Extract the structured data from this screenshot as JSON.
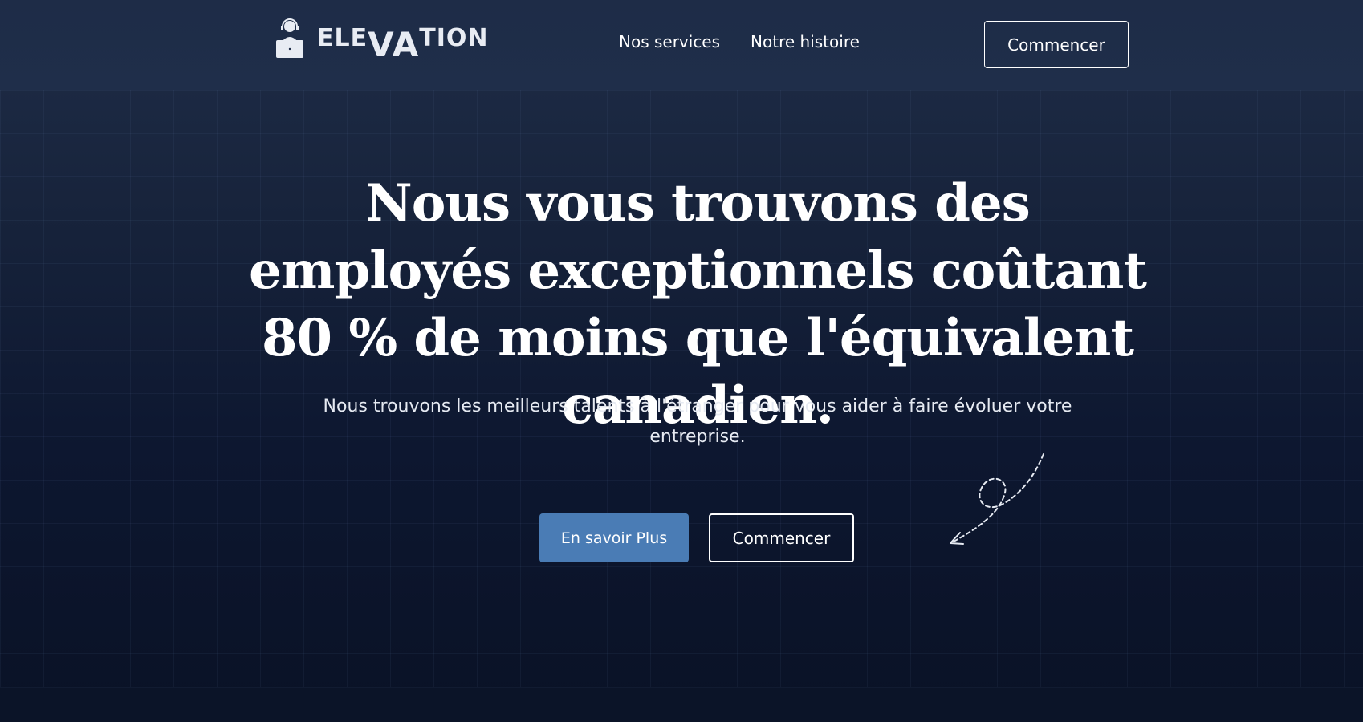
{
  "brand": {
    "name_part1": "ELE",
    "name_part2": "VA",
    "name_part3": "TION",
    "logo_icon": "support-agent-laptop-icon"
  },
  "nav": {
    "items": [
      {
        "label": "Nos services"
      },
      {
        "label": "Notre histoire"
      }
    ],
    "cta_label": "Commencer"
  },
  "hero": {
    "title": "Nous vous trouvons des employés exceptionnels coûtant 80 % de moins que l'équivalent canadien.",
    "subtitle": "Nous trouvons les meilleurs talents à l'étranger pour vous aider à faire évoluer votre entreprise.",
    "primary_button": "En savoir Plus",
    "secondary_button": "Commencer",
    "doodle_icon": "dashed-loop-arrow-icon"
  },
  "colors": {
    "background_top": "#1f2d48",
    "background_bottom": "#0a1226",
    "accent": "#4a7cb5",
    "text": "#ffffff"
  }
}
